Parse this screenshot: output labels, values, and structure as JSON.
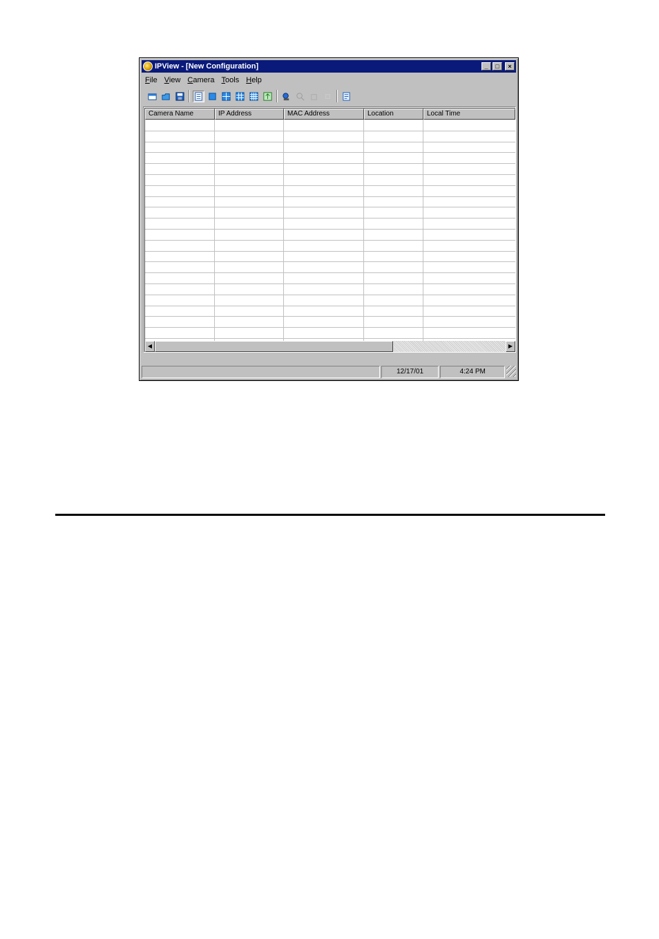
{
  "window": {
    "title": "IPView - [New Configuration]",
    "controls": {
      "minimize": "_",
      "maximize": "□",
      "close": "×"
    }
  },
  "menu": [
    {
      "label": "File",
      "mnemonic": "F",
      "rest": "ile"
    },
    {
      "label": "View",
      "mnemonic": "V",
      "rest": "iew"
    },
    {
      "label": "Camera",
      "mnemonic": "C",
      "rest": "amera"
    },
    {
      "label": "Tools",
      "mnemonic": "T",
      "rest": "ools"
    },
    {
      "label": "Help",
      "mnemonic": "H",
      "rest": "elp"
    }
  ],
  "toolbar": [
    {
      "name": "new-icon",
      "group": 1
    },
    {
      "name": "open-icon",
      "group": 1
    },
    {
      "name": "save-icon",
      "group": 1
    },
    {
      "name": "list-view-icon",
      "group": 2,
      "pressed": true
    },
    {
      "name": "single-view-icon",
      "group": 2
    },
    {
      "name": "quad-view-icon",
      "group": 2
    },
    {
      "name": "nine-view-icon",
      "group": 2
    },
    {
      "name": "sixteen-view-icon",
      "group": 2
    },
    {
      "name": "sequence-icon",
      "group": 2
    },
    {
      "name": "camera-setup-icon",
      "group": 3
    },
    {
      "name": "find-camera-icon",
      "group": 3,
      "disabled": true
    },
    {
      "name": "remove-camera-icon",
      "group": 3,
      "disabled": true
    },
    {
      "name": "blank-icon",
      "group": 3,
      "disabled": true
    },
    {
      "name": "properties-icon",
      "group": 4
    }
  ],
  "table": {
    "columns": [
      "Camera Name",
      "IP Address",
      "MAC Address",
      "Location",
      "Local Time"
    ],
    "rows": []
  },
  "status": {
    "message": "",
    "date": "12/17/01",
    "time": "4:24 PM"
  },
  "colors": {
    "titlebar": "#0a1a7a",
    "chrome": "#c0c0c0",
    "gridline": "#c0c0c0"
  }
}
